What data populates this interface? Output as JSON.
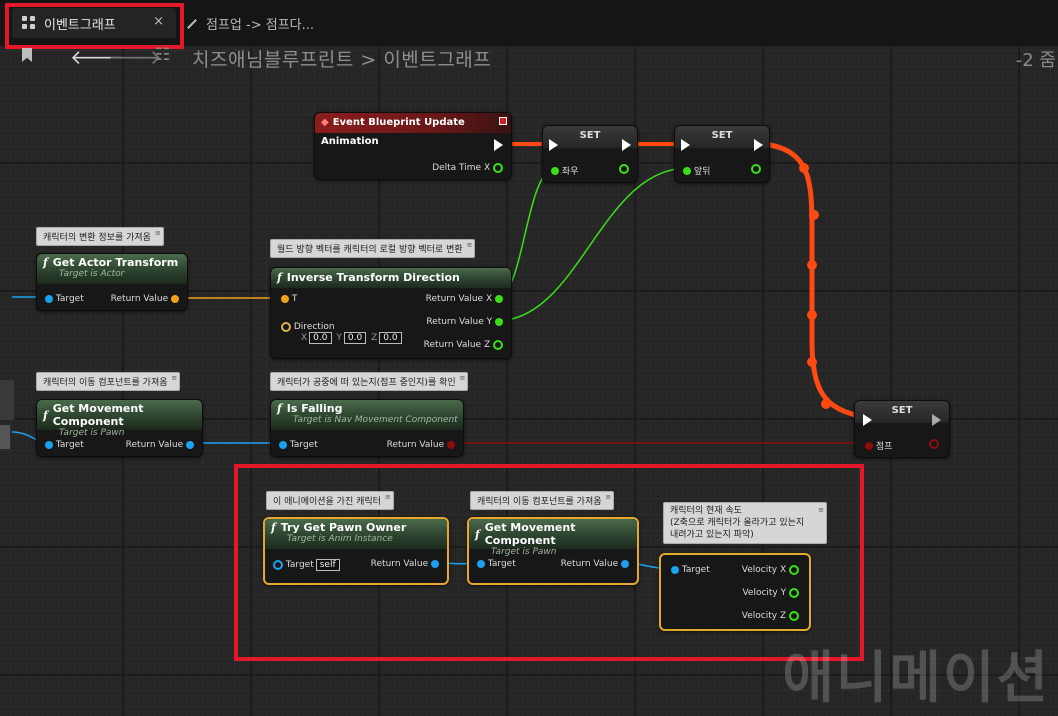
{
  "tabs": [
    {
      "label": "이벤트그래프",
      "close": "×"
    },
    {
      "label": "점프업 -> 점프다..."
    }
  ],
  "breadcrumb": {
    "path": "치즈애님블루프린트 > 이벤트그래프",
    "zoom": "-2 줌"
  },
  "watermark": "애니메이션",
  "icons": [
    "graph-tab-icon",
    "close-icon",
    "pencil-icon",
    "bookmark-icon",
    "back-arrow-icon",
    "forward-arrow-icon",
    "hierarchy-icon",
    "function-icon",
    "exec-pin-icon"
  ],
  "colors": {
    "exec_highlight": "#ff4a12",
    "float_pin": "#3adf1a",
    "object_pin": "#1aa2f0",
    "vector_pin": "#f0a318",
    "bool_pin": "#8a0e0e",
    "highlight_box": "#e4182a",
    "selected_node": "#e3a82c"
  },
  "nodes": {
    "event": {
      "title": "Event Blueprint Update Animation",
      "out": "Delta Time X"
    },
    "set1": {
      "title": "SET",
      "pin": "좌우"
    },
    "set2": {
      "title": "SET",
      "pin": "앞뒤"
    },
    "set3": {
      "title": "SET",
      "pin": "점프"
    },
    "get_transform": {
      "comment": "캐릭터의 변환 정보를 가져옴",
      "title": "Get Actor Transform",
      "sub": "Target is Actor",
      "in": "Target",
      "out": "Return Value"
    },
    "inverse": {
      "comment": "월드 방향 벡터를 캐릭터의 로컬 방향 벡터로 변환",
      "title": "Inverse Transform Direction",
      "in1": "T",
      "in2": "Direction",
      "x_label": "X",
      "y_label": "Y",
      "z_label": "Z",
      "x": "0.0",
      "y": "0.0",
      "z": "0.0",
      "outX": "Return Value X",
      "outY": "Return Value Y",
      "outZ": "Return Value Z"
    },
    "get_move1": {
      "comment": "캐릭터의 이동 컴포넌트를 가져옴",
      "title": "Get Movement Component",
      "sub": "Target is Pawn",
      "in": "Target",
      "out": "Return Value"
    },
    "is_falling": {
      "comment": "캐릭터가 공중에 떠 있는지(점프 중인지)를 확인",
      "title": "Is Falling",
      "sub": "Target is Nav Movement Component",
      "in": "Target",
      "out": "Return Value"
    },
    "try_pawn": {
      "comment": "이 애니메이션을 가진 캐릭터",
      "title": "Try Get Pawn Owner",
      "sub": "Target is Anim Instance",
      "in": "Target",
      "self": "self",
      "out": "Return Value"
    },
    "get_move2": {
      "comment": "캐릭터의 이동 컴포넌트를 가져옴",
      "title": "Get Movement Component",
      "sub": "Target is Pawn",
      "in": "Target",
      "out": "Return Value"
    },
    "velocity": {
      "comment_line1": "캐릭터의 현재 속도",
      "comment_line2": "(Z축으로 캐릭터가 올라가고 있는지",
      "comment_line3": "내려가고 있는지 파악)",
      "in": "Target",
      "outX": "Velocity X",
      "outY": "Velocity Y",
      "outZ": "Velocity Z"
    }
  }
}
